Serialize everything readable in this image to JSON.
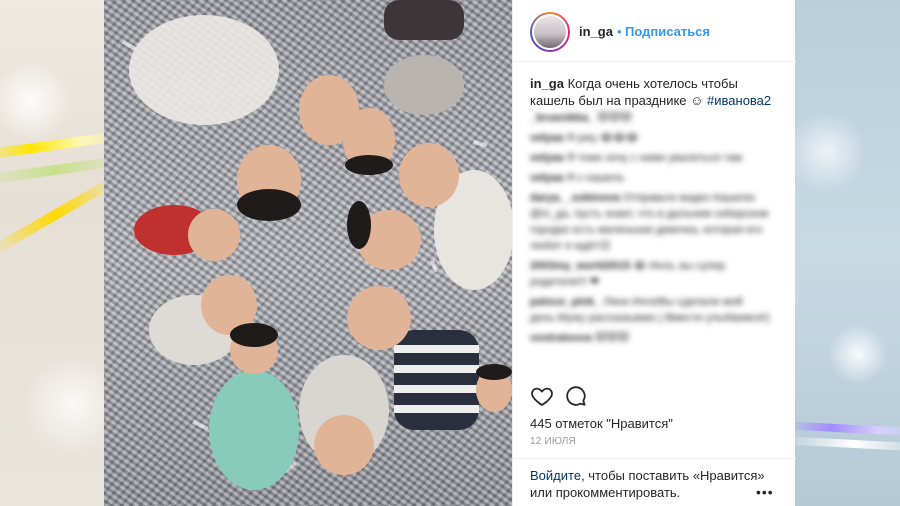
{
  "post": {
    "username": "in_ga",
    "separator": "•",
    "follow_label": "Подписаться",
    "caption": {
      "username": "in_ga",
      "text": " Когда очень хотелось чтобы кашель был на празднике ☺ ",
      "hashtag": "#иванова2"
    },
    "comments": [
      {
        "user": "_bruenikka_",
        "text": "😻😻😻"
      },
      {
        "user": "velyaa",
        "text": "Я ржу 😂😂😂"
      },
      {
        "user": "velyaa",
        "text": "Я тоже хочу с ними увалиться там"
      },
      {
        "user": "velyaa",
        "text": "Я с кашель"
      },
      {
        "user": "darya__sobinova",
        "text": "Отправьте видео Кашелю @in_ga, пусть знает, что в дальнем сибирском городке есть маленькая девочка, которая его любит и ждёт😊"
      },
      {
        "user": "2003my_world2015",
        "text": "😂 Инга, вы супер родители!!! ❤"
      },
      {
        "user": "patsus_pink_",
        "text": "Ляни Инга!Вы сделали мой день.Мужу рассказываю.) Вместе улыбаемся!)"
      },
      {
        "user": "vostratsova",
        "text": "😻😻😻"
      }
    ],
    "likes_text": "445 отметок \"Нравится\"",
    "date_text": "12 ИЮЛЯ",
    "login_link": "Войдите",
    "login_text": ", чтобы поставить «Нравится» или прокомментировать.",
    "more_label": "•••"
  },
  "icons": {
    "like": "heart-icon",
    "comment": "comment-icon",
    "more": "more-options-icon"
  },
  "colors": {
    "accent_blue": "#3897f0",
    "hashtag_blue": "#003569",
    "text": "#262626",
    "muted": "#999999"
  }
}
